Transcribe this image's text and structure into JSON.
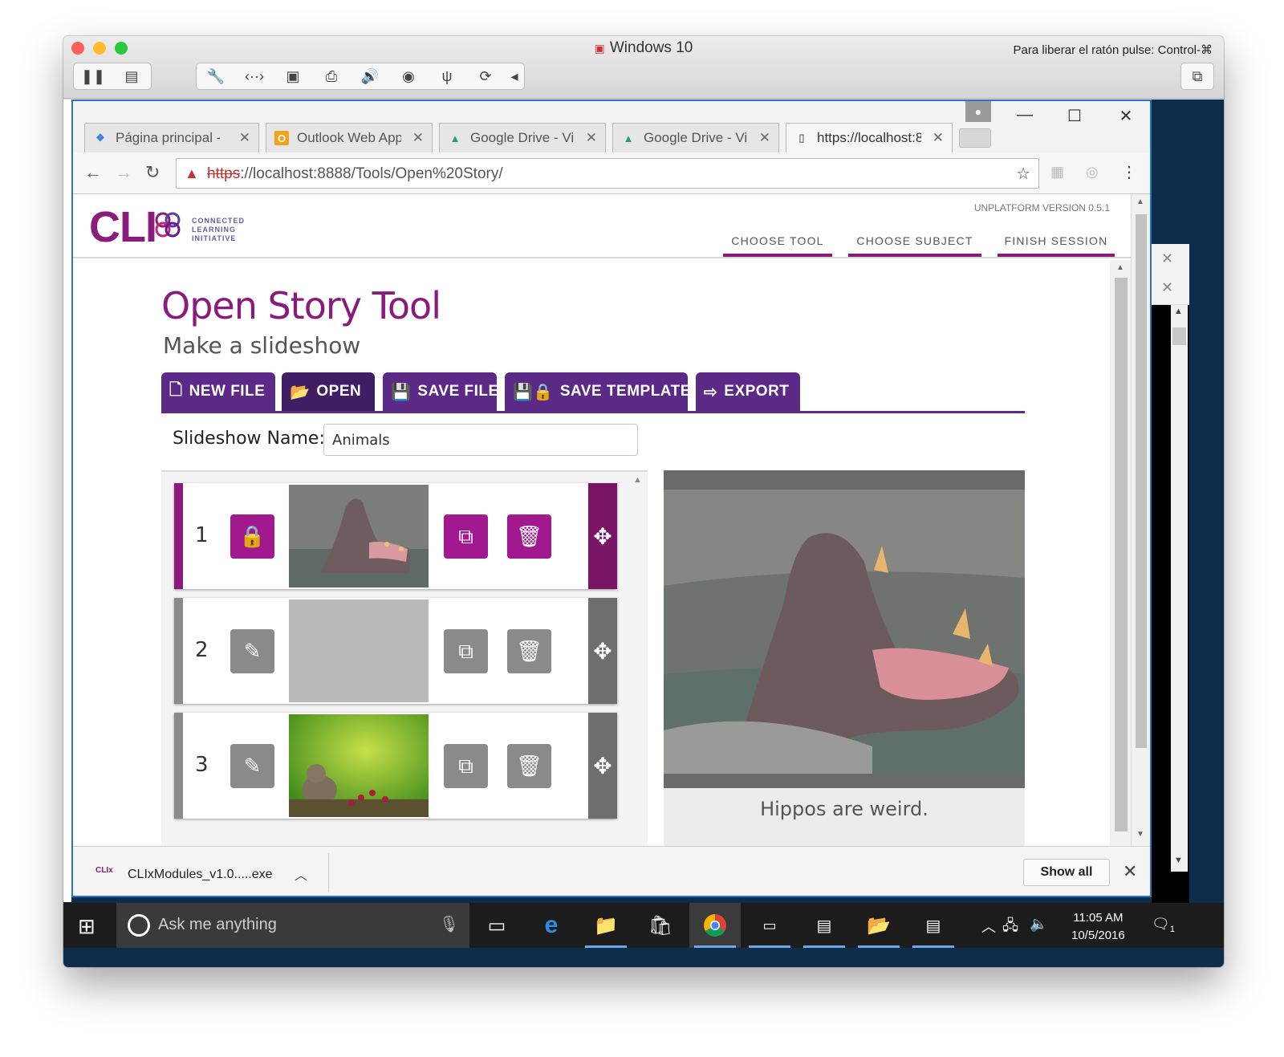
{
  "vm": {
    "title": "Windows 10",
    "hint": "Para liberar el ratón pulse: Control-⌘"
  },
  "browser": {
    "tabs": [
      {
        "label": "Página principal -"
      },
      {
        "label": "Outlook Web App"
      },
      {
        "label": "Google Drive - Vir"
      },
      {
        "label": "Google Drive - Vir"
      },
      {
        "label": "https://localhost:8"
      }
    ],
    "url": {
      "scheme": "https",
      "rest_host": "://localhost",
      "rest_path": ":8888/Tools/Open%20Story/"
    }
  },
  "app": {
    "logo": "CLI",
    "logo_sub": [
      "CONNECTED",
      "LEARNING",
      "INITIATIVE"
    ],
    "version": "UNPLATFORM VERSION 0.5.1",
    "nav": [
      "CHOOSE TOOL",
      "CHOOSE SUBJECT",
      "FINISH SESSION"
    ],
    "title": "Open Story Tool",
    "subtitle": "Make a slideshow",
    "toolbar": {
      "new_file": "NEW FILE",
      "open": "OPEN",
      "save_file": "SAVE FILE",
      "save_template": "SAVE TEMPLATE",
      "export": "EXPORT"
    },
    "slideshow_label": "Slideshow Name:",
    "slideshow_name": "Animals",
    "slides": [
      {
        "number": "1",
        "mode": "locked",
        "image": "hippo"
      },
      {
        "number": "2",
        "mode": "edit",
        "image": "empty"
      },
      {
        "number": "3",
        "mode": "edit",
        "image": "squirrel"
      }
    ],
    "preview_caption": "Hippos are weird."
  },
  "download": {
    "icon_text": "CLIx",
    "filename": "CLIxModules_v1.0.....exe",
    "show_all": "Show all"
  },
  "taskbar": {
    "search_placeholder": "Ask me anything",
    "time": "11:05 AM",
    "date": "10/5/2016",
    "notifications": "1"
  },
  "colors": {
    "brand": "#8a1a7c",
    "toolbar": "#5b2a86",
    "active_slide": "#a2198f"
  }
}
